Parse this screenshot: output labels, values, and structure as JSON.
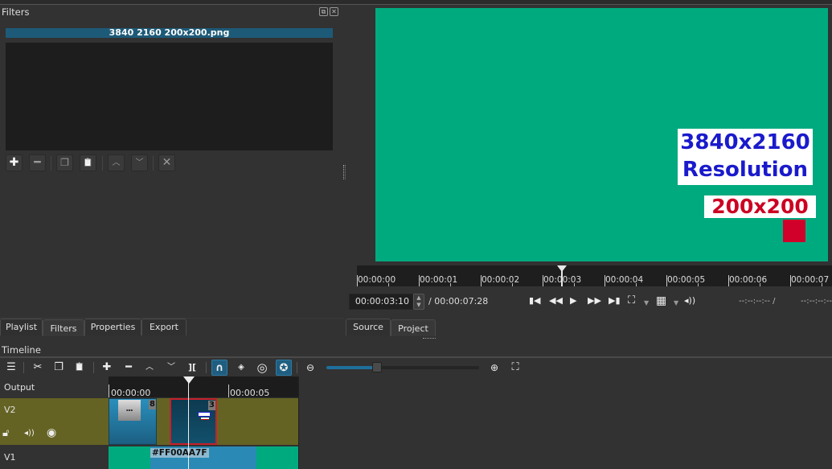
{
  "filters_panel": {
    "title": "Filters",
    "selected_clip": "3840 2160 200x200.png",
    "toolbar": [
      {
        "icon": "plus-icon",
        "glyph": "✚",
        "label": "Add filter"
      },
      {
        "icon": "minus-icon",
        "glyph": "━",
        "label": "Remove filter"
      },
      {
        "icon": "copy-icon",
        "glyph": "❐",
        "label": "Copy filters"
      },
      {
        "icon": "paste-icon",
        "glyph": "📋",
        "label": "Paste filters"
      },
      {
        "icon": "chevron-up-icon",
        "glyph": "︿",
        "label": "Move up"
      },
      {
        "icon": "chevron-down-icon",
        "glyph": "﹀",
        "label": "Move down"
      },
      {
        "icon": "close-icon",
        "glyph": "✕",
        "label": "Deselect"
      }
    ]
  },
  "preview": {
    "overlay_text_line1": "3840x2160",
    "overlay_text_line2": "Resolution",
    "overlay_size": "200x200",
    "background_color": "#00aa7f",
    "square_color": "#d0002a"
  },
  "ruler": {
    "labels": [
      "00:00:00",
      "00:00:01",
      "00:00:02",
      "00:00:03",
      "00:00:04",
      "00:00:05",
      "00:00:06",
      "00:00:07"
    ]
  },
  "transport": {
    "current_time": "00:00:03:10",
    "total_time": "/ 00:00:07:28",
    "in_point": "--:--:--:-- /",
    "out_point": "--:--:--:--",
    "buttons": [
      {
        "icon": "skip-to-start-icon",
        "glyph": "⏮"
      },
      {
        "icon": "rewind-icon",
        "glyph": "⏪"
      },
      {
        "icon": "play-icon",
        "glyph": "▶"
      },
      {
        "icon": "fast-forward-icon",
        "glyph": "⏩"
      },
      {
        "icon": "skip-to-end-icon",
        "glyph": "⏭"
      },
      {
        "icon": "zoom-fit-icon",
        "glyph": "⛶"
      },
      {
        "icon": "grid-icon",
        "glyph": "▦"
      },
      {
        "icon": "volume-icon",
        "glyph": "🔊"
      }
    ]
  },
  "left_tabs": [
    "Playlist",
    "Filters",
    "Properties",
    "Export"
  ],
  "left_tabs_active": "Filters",
  "right_tabs": [
    "Source",
    "Project"
  ],
  "right_tabs_active": "Project",
  "timeline": {
    "title": "Timeline",
    "toolbar": [
      {
        "icon": "menu-icon",
        "glyph": "☰"
      },
      {
        "icon": "cut-icon",
        "glyph": "✂"
      },
      {
        "icon": "copy-icon",
        "glyph": "❐"
      },
      {
        "icon": "paste-icon",
        "glyph": "📋"
      },
      {
        "icon": "append-icon",
        "glyph": "✚"
      },
      {
        "icon": "remove-icon",
        "glyph": "━"
      },
      {
        "icon": "lift-icon",
        "glyph": "︿"
      },
      {
        "icon": "overwrite-icon",
        "glyph": "﹀"
      },
      {
        "icon": "split-icon",
        "glyph": "]["
      },
      {
        "icon": "snap-icon",
        "glyph": "∩",
        "active": true
      },
      {
        "icon": "scrub-icon",
        "glyph": "👁"
      },
      {
        "icon": "ripple-icon",
        "glyph": "◎"
      },
      {
        "icon": "ripple-all-icon",
        "glyph": "✪",
        "active": true
      },
      {
        "icon": "zoom-out-icon",
        "glyph": "🔍"
      },
      {
        "icon": "zoom-in-icon",
        "glyph": "🔍"
      },
      {
        "icon": "zoom-fit-icon",
        "glyph": "⛶"
      }
    ],
    "zoom_level": 0.33,
    "ruler_labels": [
      "00:00:00",
      "00:00:05"
    ],
    "tracks": [
      {
        "name": "Output"
      },
      {
        "name": "V2",
        "clips": [
          {
            "label": "8"
          },
          {
            "label": "3"
          }
        ]
      },
      {
        "name": "V1",
        "clips": [
          {
            "label": "#FF00AA7F"
          }
        ]
      }
    ]
  }
}
